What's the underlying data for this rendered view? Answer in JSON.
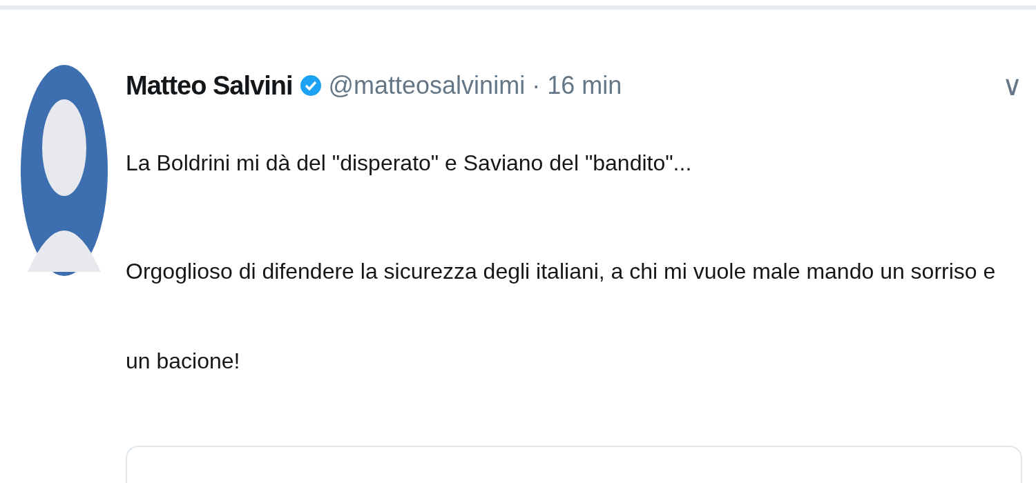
{
  "tweet": {
    "author": {
      "name": "Matteo Salvini",
      "verified": true,
      "handle": "@matteosalvinimi",
      "separator": "·",
      "time": "16 min"
    },
    "menu_icon": "∨",
    "paragraphs": [
      "La Boldrini mi dà del \"disperato\" e Saviano del \"bandito\"...",
      "Orgoglioso di difendere la sicurezza degli italiani, a chi mi vuole male mando un sorriso e un bacione!"
    ]
  }
}
